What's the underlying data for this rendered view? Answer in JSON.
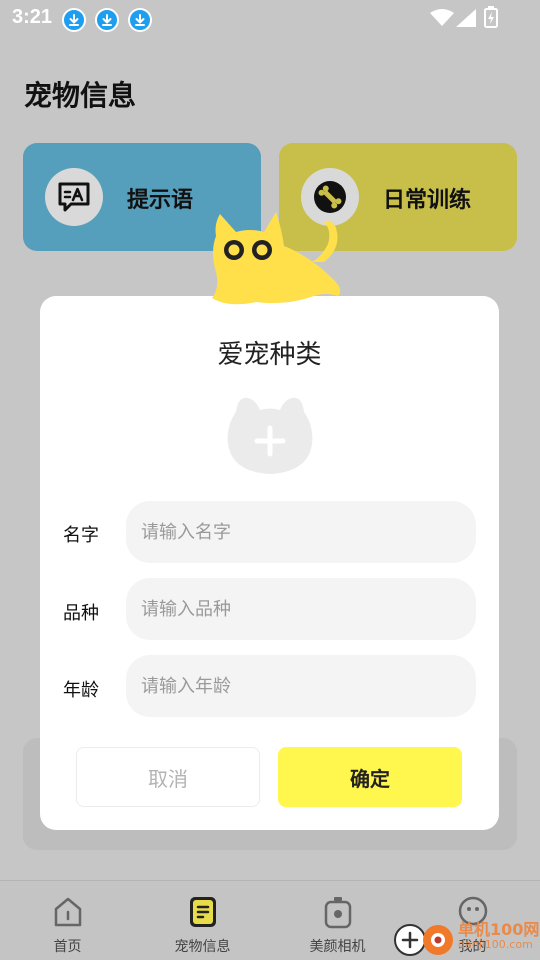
{
  "status_bar": {
    "time": "3:21",
    "icons": [
      "download-icon",
      "download-icon",
      "download-icon",
      "wifi-icon",
      "signal-icon",
      "battery-charging-icon"
    ]
  },
  "page": {
    "title": "宠物信息"
  },
  "cards": [
    {
      "label": "提示语",
      "icon": "translate-chat-icon",
      "color": "#559fbc"
    },
    {
      "label": "日常训练",
      "icon": "bone-icon",
      "color": "#c8be4a"
    }
  ],
  "dialog": {
    "title": "爱宠种类",
    "add_photo_icon": "add-pet-photo-icon",
    "fields": [
      {
        "label": "名字",
        "placeholder": "请输入名字",
        "value": ""
      },
      {
        "label": "品种",
        "placeholder": "请输入品种",
        "value": ""
      },
      {
        "label": "年龄",
        "placeholder": "请输入年龄",
        "value": ""
      }
    ],
    "cancel_label": "取消",
    "confirm_label": "确定"
  },
  "tab_bar": {
    "items": [
      {
        "label": "首页",
        "icon": "home-icon",
        "active": false
      },
      {
        "label": "宠物信息",
        "icon": "pet-info-icon",
        "active": true
      },
      {
        "label": "美颜相机",
        "icon": "camera-icon",
        "active": false
      },
      {
        "label": "我的",
        "icon": "profile-icon",
        "active": false
      }
    ]
  },
  "watermark": {
    "text": "单机100网",
    "sub": "danji100.com"
  },
  "colors": {
    "accent_yellow": "#fff64e",
    "cat_yellow": "#ffdf4a",
    "card_blue": "#559fbc",
    "card_olive": "#c8be4a"
  }
}
